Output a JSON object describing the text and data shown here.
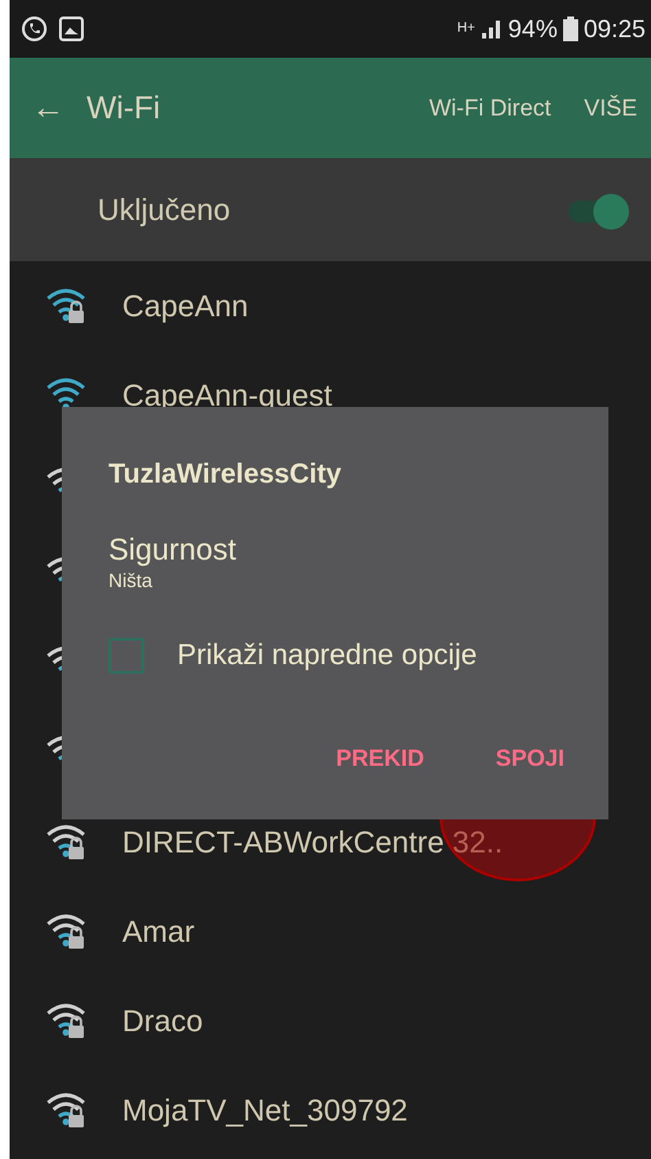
{
  "status_bar": {
    "network": "H+",
    "battery": "94%",
    "time": "09:25"
  },
  "app_bar": {
    "back": "←",
    "title": "Wi-Fi",
    "actions": [
      "Wi-Fi Direct",
      "VIŠE"
    ]
  },
  "master_switch": {
    "label": "Uključeno",
    "on": true
  },
  "networks": [
    {
      "name": "CapeAnn",
      "kind": "strong",
      "secured": true
    },
    {
      "name": "CapeAnn-quest",
      "kind": "strong",
      "secured": false
    },
    {
      "kind": "weak"
    },
    {
      "kind": "weak"
    },
    {
      "kind": "weak"
    },
    {
      "kind": "weak"
    },
    {
      "name": "DIRECT-ABWorkCentre 32..",
      "kind": "weak",
      "secured": true
    },
    {
      "name": "Amar",
      "kind": "weak",
      "secured": true
    },
    {
      "name": "Draco",
      "kind": "weak",
      "secured": true
    },
    {
      "name": "MojaTV_Net_309792",
      "kind": "weak",
      "secured": true
    }
  ],
  "dialog": {
    "title": "TuzlaWirelessCity",
    "field_label": "Sigurnost",
    "field_value": "Ništa",
    "checkbox": {
      "label": "Prikaži napredne opcije",
      "checked": false
    },
    "buttons": [
      "PREKID",
      "SPOJI"
    ]
  },
  "tap_marker": true
}
